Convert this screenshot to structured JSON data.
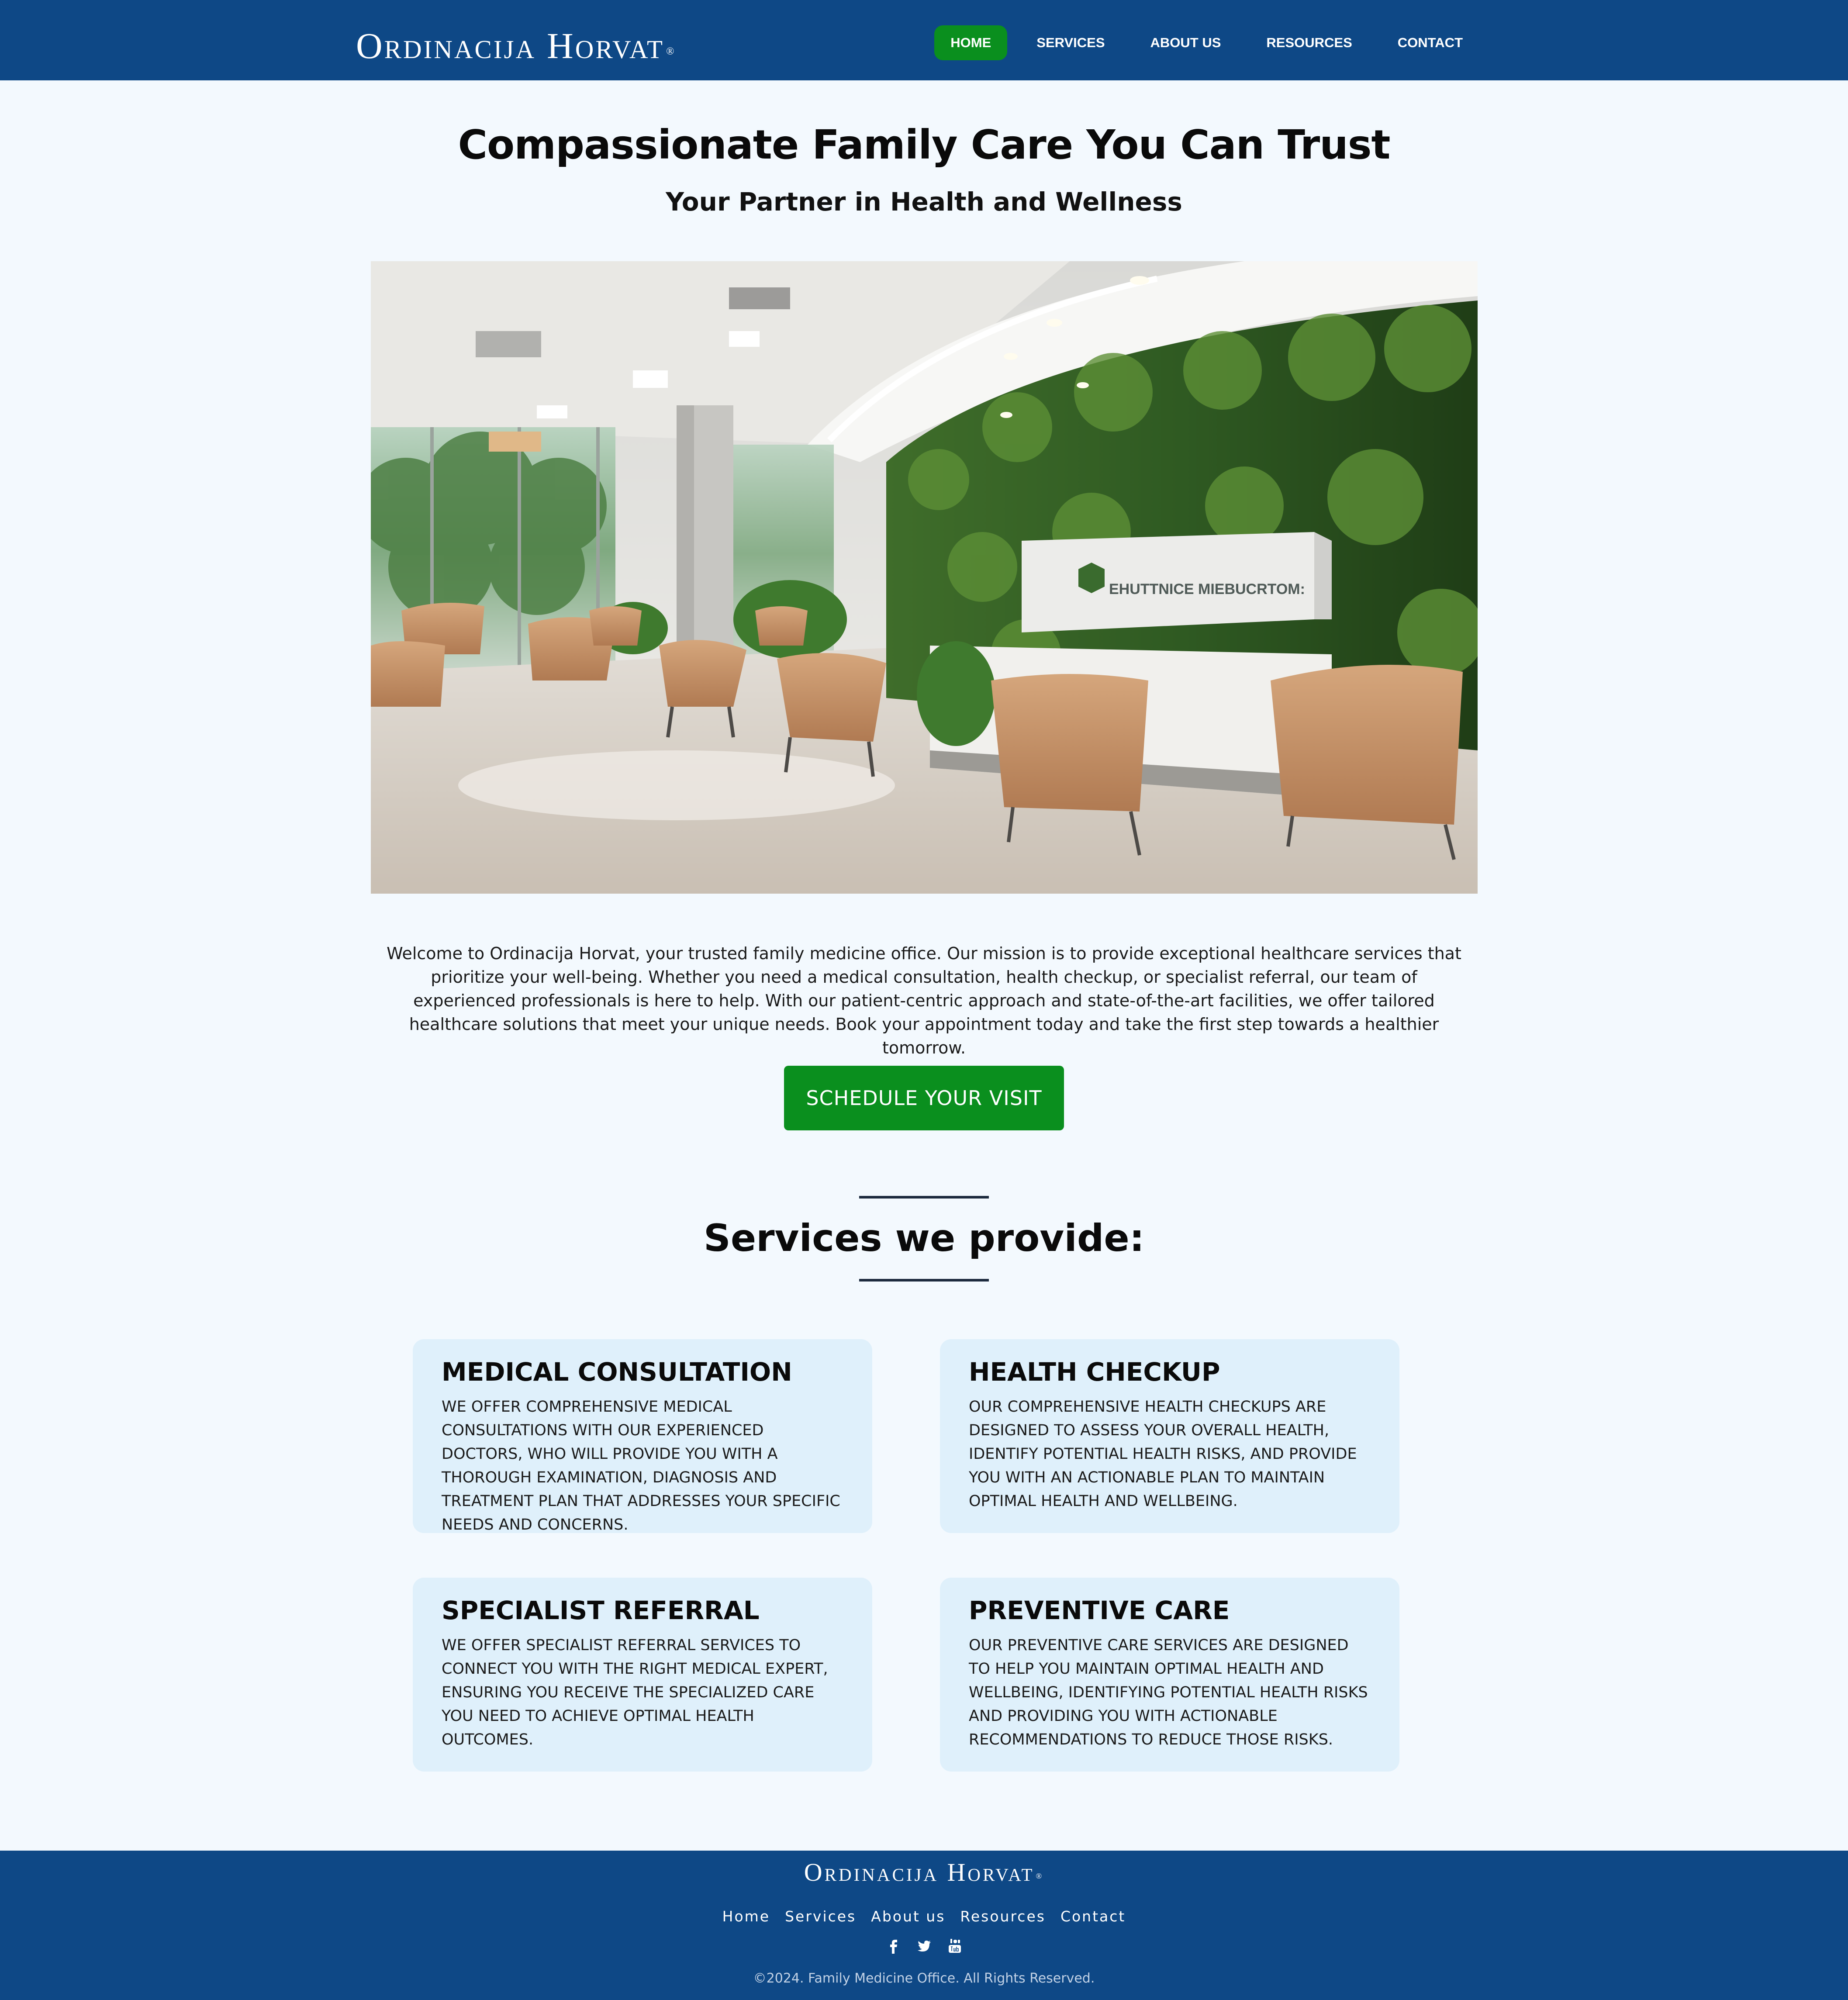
{
  "brand": {
    "name": "Ordinacija Horvat",
    "mark": "®"
  },
  "nav": {
    "items": [
      {
        "label": "Home",
        "active": true
      },
      {
        "label": "Services",
        "active": false
      },
      {
        "label": "About Us",
        "active": false
      },
      {
        "label": "Resources",
        "active": false
      },
      {
        "label": "Contact",
        "active": false
      }
    ]
  },
  "hero": {
    "title": "Compassionate Family Care You Can Trust",
    "subtitle": "Your Partner in Health and Wellness",
    "image_sign_text": "EHUTTNICE MIEBUCRTOM:"
  },
  "intro": {
    "text": "Welcome to Ordinacija Horvat, your trusted family medicine office. Our mission is to provide exceptional healthcare services that prioritize your well-being. Whether you need a medical consultation, health checkup, or specialist referral, our team of experienced professionals is here to help. With our patient-centric approach and state-of-the-art facilities, we offer tailored healthcare solutions that meet your unique needs. Book your appointment today and take the first step towards a healthier tomorrow.",
    "cta_label": "Schedule Your Visit"
  },
  "services": {
    "title": "Services we provide:",
    "cards": [
      {
        "title": "Medical Consultation",
        "text": "We offer comprehensive medical consultations with our experienced doctors, who will provide you with a thorough examination, diagnosis and treatment plan that addresses your specific needs and concerns."
      },
      {
        "title": "Health Checkup",
        "text": "Our comprehensive health checkups are designed to assess your overall health, identify potential health risks, and provide you with an actionable plan to maintain optimal health and wellbeing."
      },
      {
        "title": "Specialist Referral",
        "text": "We offer specialist referral services to connect you with the right medical expert, ensuring you receive the specialized care you need to achieve optimal health outcomes."
      },
      {
        "title": "Preventive Care",
        "text": "Our preventive care services are designed to help you maintain optimal health and wellbeing, identifying potential health risks and providing you with actionable recommendations to reduce those risks."
      }
    ]
  },
  "footer": {
    "links": [
      "Home",
      "Services",
      "About us",
      "Resources",
      "Contact"
    ],
    "social": [
      "facebook-icon",
      "twitter-icon",
      "youtube-icon"
    ],
    "copyright": "©2024. Family Medicine Office. All Rights Reserved."
  },
  "colors": {
    "header_bg": "#0e4886",
    "accent_green": "#0a8f1e",
    "page_bg": "#f3f9fe",
    "card_bg": "#dff0fb"
  }
}
